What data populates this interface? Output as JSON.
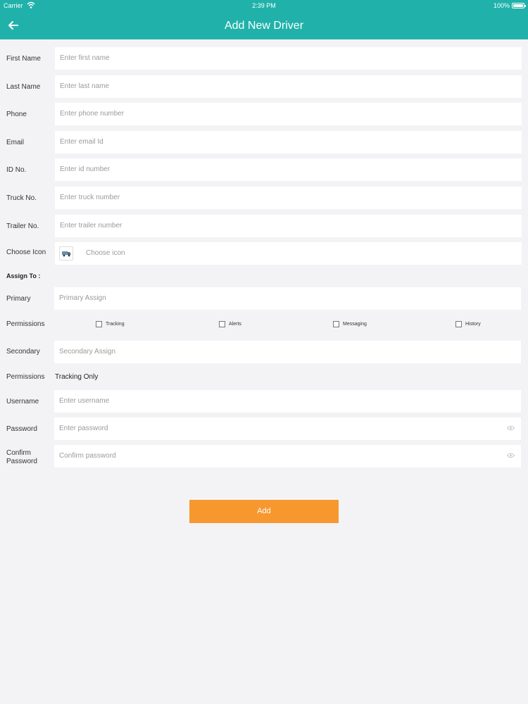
{
  "status_bar": {
    "carrier": "Carrier",
    "time": "2:39 PM",
    "battery": "100%"
  },
  "header": {
    "title": "Add New Driver",
    "color": "#20b2aa"
  },
  "form": {
    "first_name": {
      "label": "First Name",
      "placeholder": "Enter first name"
    },
    "last_name": {
      "label": "Last Name",
      "placeholder": "Enter last name"
    },
    "phone": {
      "label": "Phone",
      "placeholder": "Enter phone number"
    },
    "email": {
      "label": "Email",
      "placeholder": "Enter email Id"
    },
    "id_no": {
      "label": "ID No.",
      "placeholder": "Enter id number"
    },
    "truck_no": {
      "label": "Truck No.",
      "placeholder": "Enter truck number"
    },
    "trailer_no": {
      "label": "Trailer No.",
      "placeholder": "Enter trailer number"
    },
    "choose_icon": {
      "label": "Choose Icon",
      "placeholder": "Choose icon"
    },
    "assign_to": "Assign To :",
    "primary": {
      "label": "Primary",
      "placeholder": "Primary Assign"
    },
    "permissions": {
      "label": "Permissions",
      "options": [
        "Tracking",
        "Alerts",
        "Messaging",
        "History"
      ]
    },
    "secondary": {
      "label": "Secondary",
      "placeholder": "Secondary Assign"
    },
    "secondary_permissions": {
      "label": "Permissions",
      "value": "Tracking Only"
    },
    "username": {
      "label": "Username",
      "placeholder": "Enter username"
    },
    "password": {
      "label": "Password",
      "placeholder": "Enter password"
    },
    "confirm_password": {
      "label_line1": "Confirm",
      "label_line2": "Password",
      "placeholder": "Confirm password"
    },
    "submit_label": "Add",
    "submit_color": "#f7982f"
  }
}
